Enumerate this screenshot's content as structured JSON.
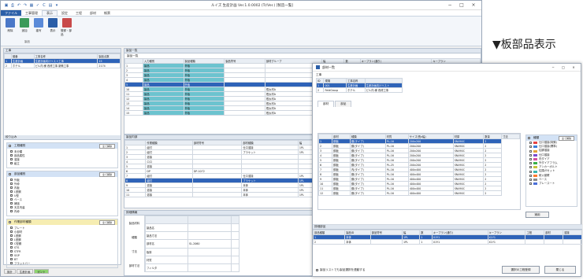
{
  "window": {
    "title": "ルイズ 生産計画 Ver.1.0.0002 (Tr/Ver.) [製造一覧]",
    "qa_icons": [
      "save-icon",
      "print-icon",
      "undo-icon",
      "redo-icon",
      "table-icon",
      "check-icon",
      "c-icon",
      "grid-icon",
      "dropdown-icon"
    ],
    "min": "−",
    "max": "□",
    "close": "×"
  },
  "ribbon_tabs": [
    "ファイル",
    "工事管理",
    "表示",
    "設定",
    "工程",
    "部材",
    "帳票"
  ],
  "ribbon": {
    "buttons": [
      "削除",
      "追加",
      "複写",
      "表示",
      "登録・部品"
    ],
    "group": "製品"
  },
  "caption": "▼板部品表示",
  "left_panel": {
    "header": "工事",
    "columns": [
      "順番",
      "工事名称",
      "製品点数"
    ],
    "rows": [
      [
        "1",
        "生産計画",
        "生産計画向けリスト工事",
        "15"
      ],
      [
        "2",
        "ホテル",
        "ビル内 様 改修工事 新築工事",
        "2174"
      ]
    ]
  },
  "filter_panel": {
    "header": "絞り込み",
    "groups": [
      {
        "title": "工程種別",
        "button": "全て解除",
        "items": [
          "未分類",
          "部品属性",
          "溶接",
          "組立"
        ]
      },
      {
        "title": "部品種別",
        "button": "全て解除",
        "items": [
          "外板",
          "外枠",
          "内板",
          "L型鋼",
          "U型",
          "ベース",
          "補強",
          "天井内装",
          "内枠"
        ]
      },
      {
        "title": "作業部材種類",
        "button": "全て解除",
        "items": [
          "プレート",
          "小部材",
          "L型鋼",
          "L型鋼",
          "C型鋼",
          "STS",
          "STFR",
          "SGP",
          "BT",
          "フラットバー"
        ]
      }
    ]
  },
  "tabs": [
    "設計",
    "生産計画",
    "ガント"
  ],
  "grid_top": {
    "header": "製品一覧",
    "sub": "製品一覧",
    "columns": [
      "",
      "入力種別",
      "製品種類",
      "製品符号",
      "部材グループ",
      "幅",
      "数",
      "キープラン(通り)",
      "キープラン"
    ],
    "rows": [
      [
        "1",
        "製品",
        "外板",
        "",
        "",
        "2PL",
        "1",
        "X1Y1",
        ""
      ],
      [
        "2",
        "製品",
        "外板",
        "",
        "",
        "2PL",
        "1",
        "X1Y1",
        ""
      ],
      [
        "3",
        "製品",
        "外板",
        "",
        "",
        "2PL",
        "1",
        "X1Y1",
        ""
      ],
      [
        "4",
        "製品",
        "外板",
        "",
        "",
        "2PL",
        "1",
        "X1Y1",
        ""
      ],
      [
        "5",
        "製品",
        "外板",
        "",
        "",
        "2PL",
        "1",
        "X1Y1",
        ""
      ],
      [
        "10",
        "製品",
        "外板",
        "",
        "根太材A",
        "2PL",
        "1",
        "X1Y2",
        ""
      ],
      [
        "11",
        "製品",
        "外板",
        "",
        "根太材A",
        "2PL",
        "1",
        "X1Y2",
        ""
      ],
      [
        "12",
        "製品",
        "外板",
        "",
        "根太材A",
        "2PL",
        "1",
        "X1Y2",
        ""
      ],
      [
        "13",
        "製品",
        "外板",
        "",
        "根太材A",
        "2PL",
        "1",
        "X1Y2",
        ""
      ],
      [
        "14",
        "製品",
        "外板",
        "",
        "根太材A",
        "2PL",
        "1",
        "X1Y2",
        ""
      ],
      [
        "15",
        "製品",
        "外板",
        "",
        "根太材A",
        "2PL",
        "1",
        "X1Y2",
        ""
      ]
    ],
    "selected_row": 4
  },
  "grid_mid": {
    "header": "製品内部",
    "columns": [
      "",
      "作業種類",
      "部材符号",
      "部材種類",
      "幅",
      "数",
      "キープラン(通り)",
      "キープラン"
    ],
    "rows": [
      [
        "1",
        "組付",
        "",
        "仕口溶接",
        "1PL",
        "1",
        "X1Y2",
        "X1Y2"
      ],
      [
        "2",
        "組付",
        "",
        "ブラケット",
        "1PL",
        "1",
        "X1Y2",
        "X1Y2"
      ],
      [
        "3",
        "溶接",
        "",
        "",
        "",
        "",
        "",
        ""
      ],
      [
        "4",
        "ロロ",
        "",
        "",
        "",
        "",
        "",
        ""
      ],
      [
        "5",
        "溶接",
        "",
        "",
        "",
        "",
        "",
        ""
      ],
      [
        "6",
        "DP",
        "DP-1072",
        "",
        "",
        "",
        "",
        ""
      ],
      [
        "7",
        "組付",
        "",
        "仕口溶接",
        "1PL",
        "1",
        "X1Y2",
        "X1Y2"
      ],
      [
        "8",
        "組付",
        "",
        "ブラケット",
        "1PL",
        "1",
        "X1Y2",
        "X1Y2"
      ],
      [
        "9",
        "溶接",
        "",
        "本体",
        "1PL",
        "1",
        "X1Y2",
        "X1Y2"
      ],
      [
        "10",
        "溶接",
        "",
        "本体",
        "1PL",
        "1",
        "X1Y2",
        "X1Y2"
      ],
      [
        "11",
        "溶接",
        "",
        "本体",
        "1PL",
        "1",
        "X1Y2",
        "X1Y2"
      ]
    ],
    "selected_row": 7
  },
  "detail": {
    "header": "詳細情報",
    "left": [
      "製品材料",
      "種類",
      "寸法",
      "部材寸法"
    ],
    "rows": [
      [
        "製品名",
        "",
        ""
      ],
      [
        "製品寸法",
        "",
        ""
      ],
      [
        "部材名",
        "SL-2060",
        ""
      ],
      [
        "板厚",
        "",
        ""
      ],
      [
        "材質",
        "",
        ""
      ],
      [
        "フィルタ",
        "",
        ""
      ]
    ]
  },
  "dialog": {
    "title": "部材一覧",
    "header_label": "工事",
    "cols": [
      "ID",
      "現場",
      "工事名称"
    ],
    "rows": [
      [
        "1",
        "001",
        "生産計画",
        "生産計画向けリスト"
      ],
      [
        "2",
        "FeldGroup",
        "ホテル",
        "ビル内 様 改修工事"
      ]
    ],
    "tabs": [
      "部材",
      "部品"
    ],
    "grid_cols": [
      "部材",
      "種類",
      "材質",
      "サイズ(長x幅)",
      "材厚",
      "数量",
      "寸法"
    ],
    "grid_rows": [
      [
        "1",
        "鋼板",
        "鋼(タイプ)",
        "PL-16",
        "200x200",
        "SN490C",
        "2"
      ],
      [
        "2",
        "鋼板",
        "鋼(タイプ)",
        "PL-16",
        "200x200",
        "SN490C",
        "2"
      ],
      [
        "3",
        "鋼板",
        "鋼(タイプ)",
        "PL-16",
        "200x200",
        "SN490C",
        "2"
      ],
      [
        "4",
        "鋼板",
        "鋼(タイプ)",
        "PL-16",
        "200x200",
        "SN490C",
        "2"
      ],
      [
        "5",
        "鋼板",
        "鋼(タイプ)",
        "PL-16",
        "200x200",
        "SN490C",
        "2"
      ],
      [
        "6",
        "鋼板",
        "鋼(タイプ)",
        "PL-25",
        "200x200",
        "SN490C",
        "2"
      ],
      [
        "7",
        "鋼板",
        "内(タイプ)",
        "PL-16",
        "400x400",
        "SN490C",
        "2"
      ],
      [
        "8",
        "鋼板",
        "鋼(タイプ)",
        "PL-16",
        "400x400",
        "SN490C",
        "2"
      ],
      [
        "9",
        "鋼板",
        "鋼(タイプ)",
        "PL-16",
        "400x400",
        "SN490C",
        "2"
      ],
      [
        "10",
        "鋼板",
        "鋼(タイプ)",
        "PL-16",
        "400x400",
        "SN490C",
        "2"
      ],
      [
        "11",
        "鋼板",
        "鋼(タイプ)",
        "PL-16",
        "400x400",
        "SN490C",
        "2"
      ],
      [
        "12",
        "鋼板",
        "鋼(タイプ)",
        "PL-16",
        "400x400",
        "SN490C",
        "2"
      ]
    ],
    "legend": {
      "title": "種類",
      "button": "全て解除",
      "items": [
        "仕口溶接(特殊)",
        "仕口溶接(標準)",
        "柱脚溶接",
        "仕口溶接",
        "内ダイア",
        "外ダイアフラム",
        "アンカーボルト",
        "柱頭ガセット",
        "耐火被覆",
        "ベース",
        "プレースート"
      ],
      "colors": [
        "#e64545",
        "#3a7fdc",
        "#e4a33a",
        "#7a4bd0",
        "#d44ea2",
        "#38b04a",
        "#c4c33a",
        "#3ab6b0",
        "#ff7a2e",
        "#8a8a8a",
        "#4a6fd8"
      ]
    },
    "apply": "適用",
    "lower_header": "詳細部品",
    "lower_cols": [
      "部品種類",
      "製品ID",
      "部品符号",
      "幅",
      "数",
      "キープラン(通り)",
      "キープラン",
      "工程",
      "部材",
      "溶接"
    ],
    "lower_rows": [
      [
        "1",
        "本体",
        "",
        "1PL",
        "1",
        "X1Y1",
        "X1Y1",
        "",
        "",
        ""
      ],
      [
        "2",
        "本体",
        "",
        "1PL",
        "1",
        "X1Y1",
        "X1Y1",
        "",
        "",
        ""
      ]
    ],
    "check_label": "製品リストでも製品選択を連動する",
    "btn_ok": "選択の工程登録",
    "btn_close": "閉じる"
  }
}
